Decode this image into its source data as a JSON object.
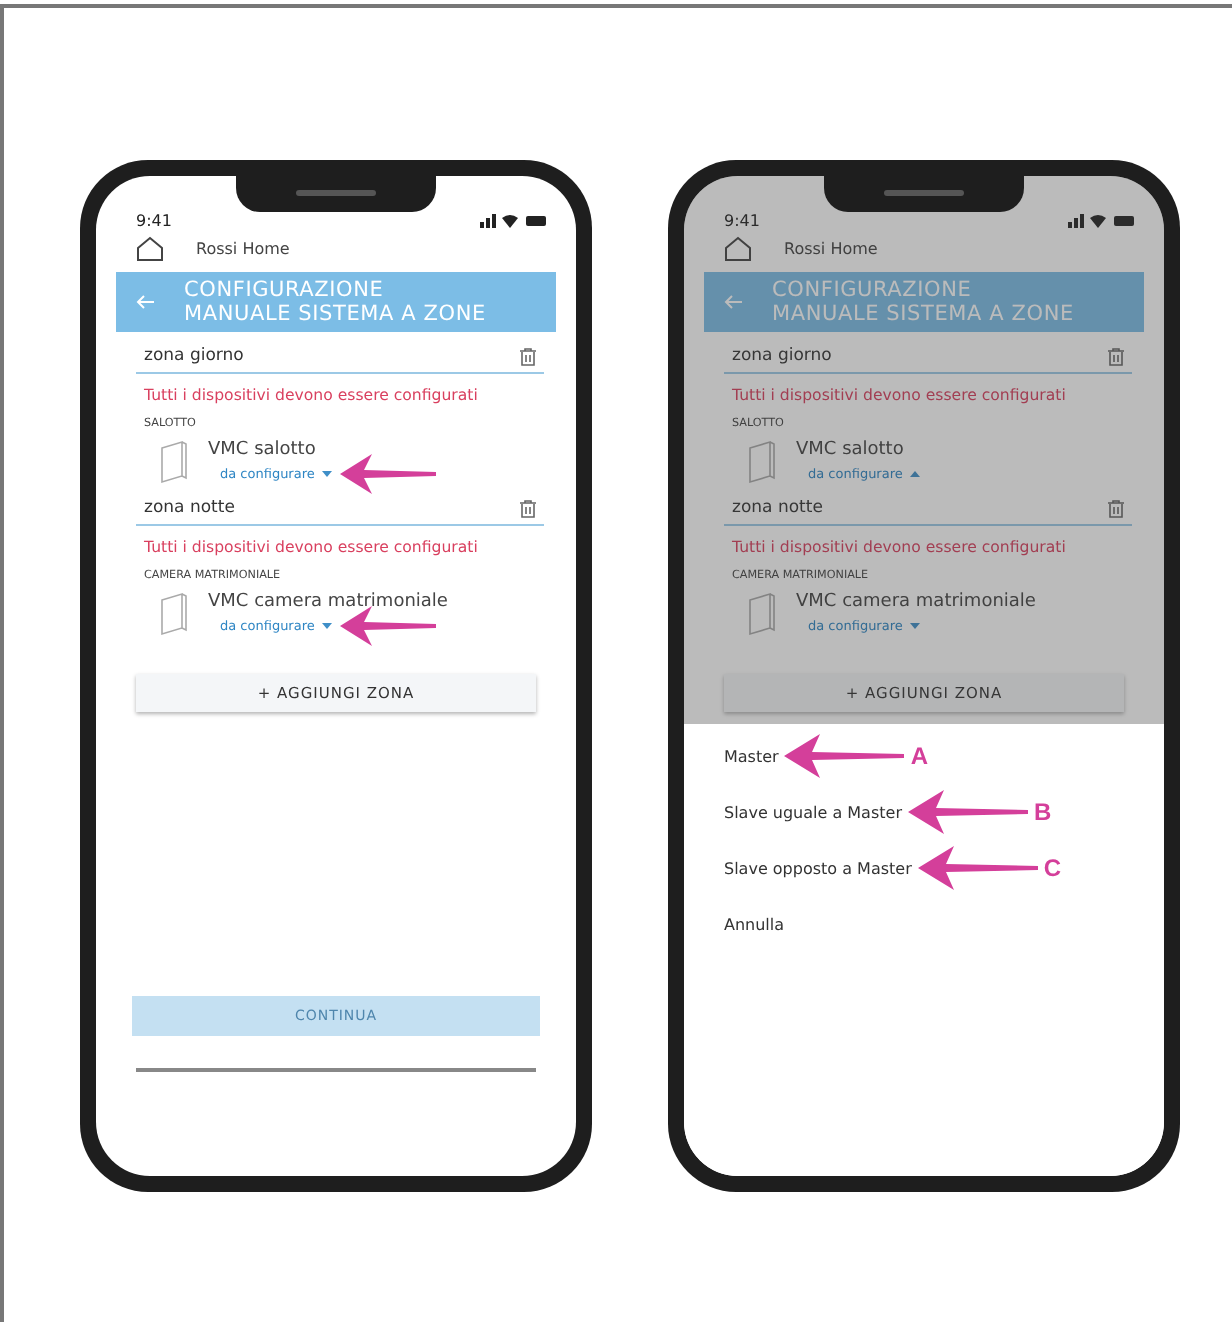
{
  "phones": [
    {
      "status_time": "9:41",
      "home": "Rossi Home",
      "title": [
        "CONFIGURAZIONE",
        "MANUALE SISTEMA A ZONE"
      ],
      "dimmed": false,
      "zones": [
        {
          "name": "zona giorno",
          "warning": "Tutti i dispositivi devono essere configurati",
          "room": "SALOTTO",
          "device": "VMC  salotto",
          "status": "da configurare",
          "expanded": false,
          "arrow": true
        },
        {
          "name": "zona notte",
          "warning": "Tutti i dispositivi devono essere configurati",
          "room": "CAMERA MATRIMONIALE",
          "device": "VMC  camera matrimoniale",
          "status": "da configurare",
          "expanded": false,
          "arrow": true
        }
      ],
      "add_button": "+ AGGIUNGI ZONA",
      "continue_button": {
        "label": "CONTINUA",
        "disabled": true
      }
    },
    {
      "status_time": "9:41",
      "home": "Rossi Home",
      "title": [
        "CONFIGURAZIONE",
        "MANUALE SISTEMA A ZONE"
      ],
      "dimmed": true,
      "zones": [
        {
          "name": "zona giorno",
          "warning": "Tutti i dispositivi devono essere configurati",
          "room": "SALOTTO",
          "device": "VMC  salotto",
          "status": "da configurare",
          "expanded": true,
          "arrow": false
        },
        {
          "name": "zona notte",
          "warning": "Tutti i dispositivi devono essere configurati",
          "room": "CAMERA MATRIMONIALE",
          "device": "VMC  camera matrimoniale",
          "status": "da configurare",
          "expanded": false,
          "arrow": false
        }
      ],
      "add_button": "+ AGGIUNGI ZONA",
      "sheet": [
        {
          "label": "Master",
          "callout": "A"
        },
        {
          "label": "Slave uguale a Master",
          "callout": "B"
        },
        {
          "label": "Slave opposto a Master",
          "callout": "C"
        },
        {
          "label": "Annulla"
        }
      ]
    }
  ]
}
